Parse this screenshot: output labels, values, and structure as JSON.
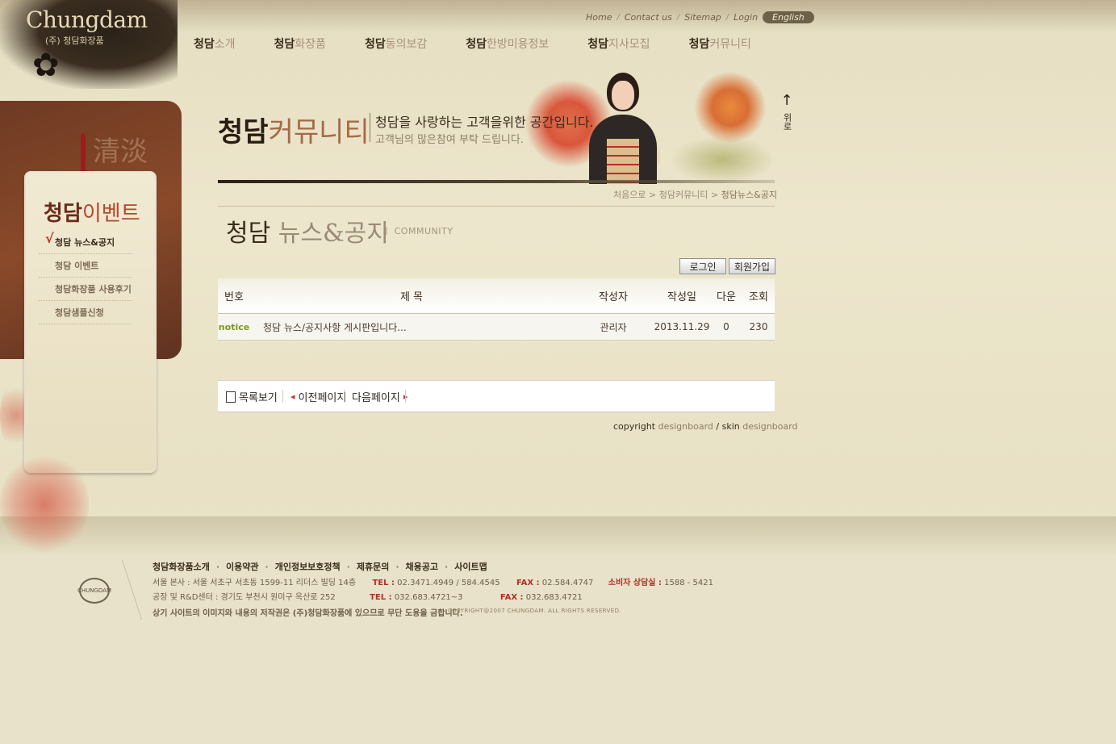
{
  "logo": {
    "brand": "Chungdam",
    "sub": "(주) 청담화장품"
  },
  "util_nav": {
    "home": "Home",
    "contact": "Contact us",
    "sitemap": "Sitemap",
    "login": "Login",
    "english": "English"
  },
  "gnb": [
    {
      "main": "청담",
      "sub": "소개"
    },
    {
      "main": "청담",
      "sub": "화장품"
    },
    {
      "main": "청담",
      "sub": "동의보감"
    },
    {
      "main": "청담",
      "sub": "한방미용정보"
    },
    {
      "main": "청담",
      "sub": "지사모집"
    },
    {
      "main": "청담",
      "sub": "커뮤니티"
    }
  ],
  "banner": {
    "title_main": "청담",
    "title_sub": "커뮤니티",
    "line1": "청담을 사랑하는 고객을위한 공간입니다.",
    "line2": "고객님의 많은참여 부탁 드립니다."
  },
  "top_button": {
    "arrow": "↑",
    "label": "위로"
  },
  "breadcrumb": {
    "home": "처음으로",
    "sep1": ">",
    "section": "청담커뮤니티",
    "sep2": ">",
    "current": "청담뉴스&공지"
  },
  "page_title": {
    "main": "청담",
    "sub": "뉴스&공지",
    "eng": "COMMUNITY"
  },
  "buttons": {
    "login": "로그인",
    "join": "회원가입"
  },
  "board": {
    "headers": {
      "no": "번호",
      "title": "제 목",
      "writer": "작성자",
      "date": "작성일",
      "down": "다운",
      "view": "조회"
    },
    "rows": [
      {
        "no": "notice",
        "title": "청담 뉴스/공지사항 게시판입니다...",
        "writer": "관리자",
        "date": "2013.11.29",
        "down": "0",
        "view": "230"
      }
    ]
  },
  "board_nav": {
    "list": "목록보기",
    "prev": "이전페이지",
    "next": "다음페이지",
    "prev_arrow": "◂",
    "next_arrow": "▸"
  },
  "copyright": {
    "label": "copyright",
    "c_owner": "designboard",
    "slash": "/",
    "skin_label": "skin",
    "skin_owner": "designboard"
  },
  "sidebar": {
    "title_main": "청담",
    "title_sub": "이벤트",
    "check": "√",
    "items": [
      {
        "label": "청담 뉴스&공지"
      },
      {
        "label": "청담 이벤트"
      },
      {
        "label": "청담화장품 사용후기"
      },
      {
        "label": "청담샘플신청"
      }
    ]
  },
  "footer": {
    "logo_text": "CHUNGDAM",
    "links": [
      "청담화장품소개",
      "이용약관",
      "개인정보보호정책",
      "제휴문의",
      "채용공고",
      "사이트맵"
    ],
    "link_sep": "·",
    "hq": "서울 본사 : 서울 서초구 서초동 1599-11 리더스 빌딩 14층",
    "hq_tel_label": "TEL :",
    "hq_tel": "02.3471.4949 / 584.4545",
    "hq_fax_label": "FAX :",
    "hq_fax": "02.584.4747",
    "cs_label": "소비자 상담실 :",
    "cs_tel": "1588 - 5421",
    "factory": "공장 및 R&D센터 : 경기도 부천시 원미구 옥산로 252",
    "factory_tel_label": "TEL :",
    "factory_tel": "032.683.4721~3",
    "factory_fax_label": "FAX :",
    "factory_fax": "032.683.4721",
    "notice": "상기 사이트의 이미지와 내용의 저작권은 (주)청담화장품에 있으므로 무단 도용을 금합니다.",
    "copyright": "COPYRIGHT@2007 CHUNGDAM. ALL RIGHTS RESERVED."
  }
}
